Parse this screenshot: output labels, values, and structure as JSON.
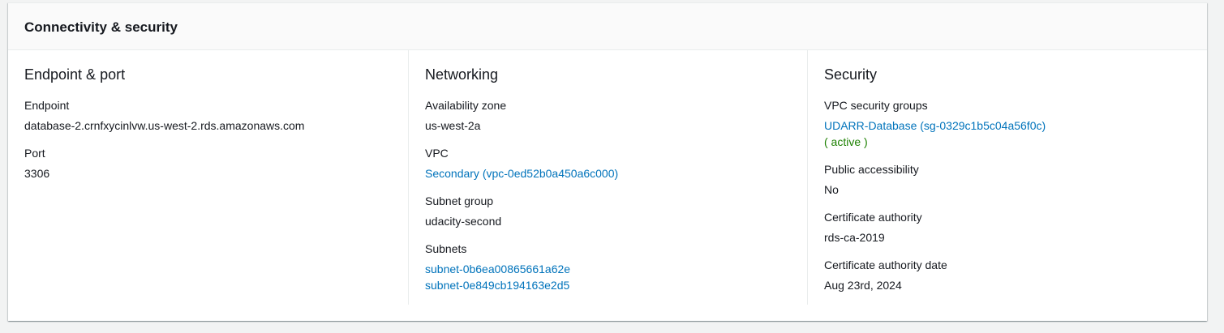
{
  "panel": {
    "title": "Connectivity & security"
  },
  "endpoint_port": {
    "title": "Endpoint & port",
    "endpoint_label": "Endpoint",
    "endpoint_value": "database-2.crnfxycinlvw.us-west-2.rds.amazonaws.com",
    "port_label": "Port",
    "port_value": "3306"
  },
  "networking": {
    "title": "Networking",
    "az_label": "Availability zone",
    "az_value": "us-west-2a",
    "vpc_label": "VPC",
    "vpc_value": "Secondary (vpc-0ed52b0a450a6c000)",
    "subnet_group_label": "Subnet group",
    "subnet_group_value": "udacity-second",
    "subnets_label": "Subnets",
    "subnets": [
      "subnet-0b6ea00865661a62e",
      "subnet-0e849cb194163e2d5"
    ]
  },
  "security": {
    "title": "Security",
    "sg_label": "VPC security groups",
    "sg_value": "UDARR-Database (sg-0329c1b5c04a56f0c)",
    "sg_status": "( active )",
    "public_label": "Public accessibility",
    "public_value": "No",
    "ca_label": "Certificate authority",
    "ca_value": "rds-ca-2019",
    "ca_date_label": "Certificate authority date",
    "ca_date_value": "Aug 23rd, 2024"
  },
  "colors": {
    "link": "#0073bb",
    "success": "#1d8102",
    "text": "#16191f",
    "border": "#eaeded",
    "background": "#f2f3f3"
  }
}
